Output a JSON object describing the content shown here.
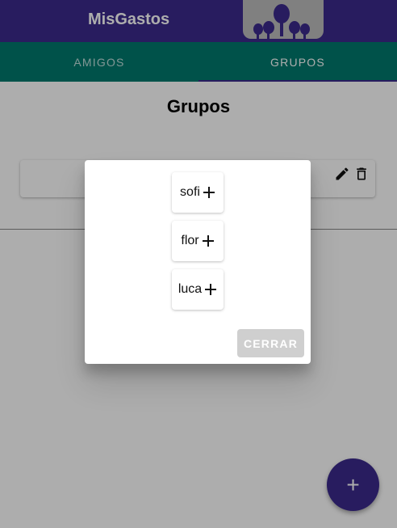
{
  "app": {
    "title": "MisGastos",
    "colors": {
      "primary": "#3b2a8c",
      "tabs": "#007a6e",
      "disabled_button": "#cfcfcf"
    },
    "logo_icon": "group-people-icon"
  },
  "tabs": [
    {
      "label": "AMIGOS",
      "selected": false
    },
    {
      "label": "GRUPOS",
      "selected": true
    }
  ],
  "page": {
    "title": "Grupos",
    "group_card": {
      "edit_icon": "pencil-icon",
      "delete_icon": "trash-icon"
    },
    "fab": {
      "label": "+",
      "icon": "plus-icon"
    }
  },
  "dialog": {
    "members": [
      {
        "name": "sofi",
        "icon": "plus-icon"
      },
      {
        "name": "flor",
        "icon": "plus-icon"
      },
      {
        "name": "luca",
        "icon": "plus-icon"
      }
    ],
    "close_label": "CERRAR"
  }
}
